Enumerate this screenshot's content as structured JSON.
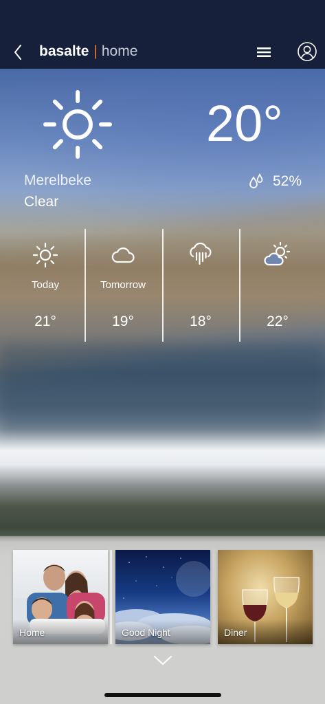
{
  "header": {
    "brand_primary": "basalte",
    "brand_separator": "|",
    "brand_secondary": "home",
    "back_icon": "chevron-left-icon",
    "menu_icon": "hamburger-icon",
    "profile_icon": "user-circle-icon"
  },
  "weather": {
    "current_icon": "sun-icon",
    "temperature": "20°",
    "city": "Merelbeke",
    "condition": "Clear",
    "humidity_icon": "humidity-drops-icon",
    "humidity": "52%"
  },
  "forecast": [
    {
      "day": "Today",
      "temp": "21°",
      "icon": "sun-icon"
    },
    {
      "day": "Tomorrow",
      "temp": "19°",
      "icon": "cloud-icon"
    },
    {
      "day": "",
      "temp": "18°",
      "icon": "rain-cloud-icon"
    },
    {
      "day": "",
      "temp": "22°",
      "icon": "partly-cloudy-icon"
    }
  ],
  "scenes": [
    {
      "label": "Home"
    },
    {
      "label": "Good Night"
    },
    {
      "label": "Diner"
    }
  ],
  "colors": {
    "topbar": "#16203a",
    "brand_separator": "#e8742a",
    "text": "#ffffff"
  }
}
